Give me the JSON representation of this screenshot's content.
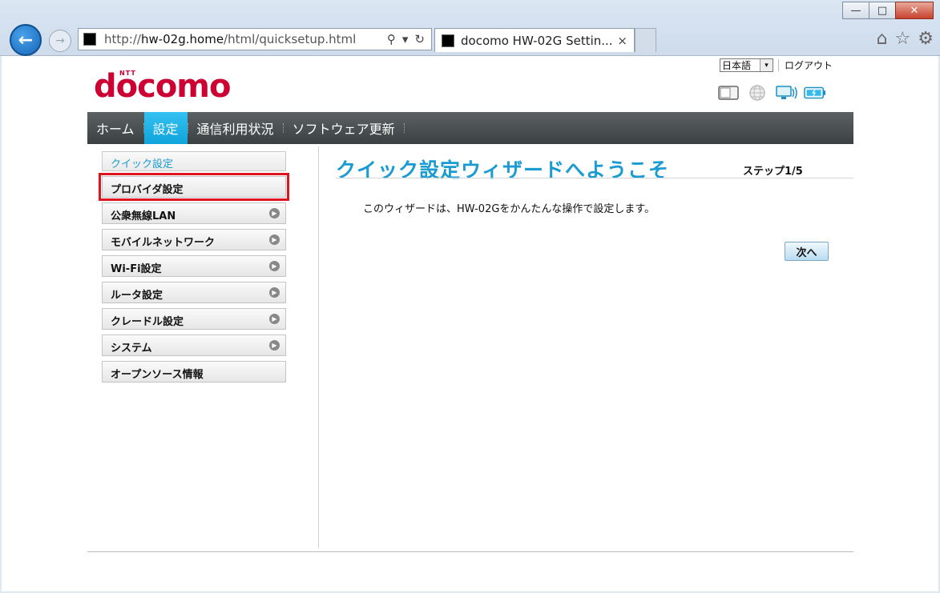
{
  "browser": {
    "url_prefix": "http://",
    "url_host": "hw-02g.home",
    "url_path": "/html/quicksetup.html",
    "tab_title": "docomo HW-02G Settin...",
    "tab_close": "×",
    "back_glyph": "←",
    "forward_glyph": "→",
    "window_buttons": {
      "minimize": "—",
      "maximize": "□",
      "close": "✕"
    },
    "address_icons": {
      "search": "⚲",
      "dropdown": "▾",
      "refresh": "↻"
    },
    "toolbar_icons": {
      "home": "⌂",
      "favorites": "☆",
      "settings": "⚙"
    }
  },
  "header": {
    "logo_text": "docomo",
    "logo_sub": "NTT",
    "language": "日本語",
    "language_arrow": "▾",
    "logout": "ログアウト",
    "status_icons": [
      "sim-icon",
      "globe-icon",
      "wifi-client-icon",
      "battery-icon"
    ]
  },
  "nav": {
    "items": [
      {
        "label": "ホーム"
      },
      {
        "label": "設定"
      },
      {
        "label": "通信利用状況"
      },
      {
        "label": "ソフトウェア更新"
      }
    ]
  },
  "sidebar": {
    "heading": "クイック設定",
    "items": [
      {
        "label": "プロバイダ設定"
      },
      {
        "label": "公衆無線LAN"
      },
      {
        "label": "モバイルネットワーク"
      },
      {
        "label": "Wi-Fi設定"
      },
      {
        "label": "ルータ設定"
      },
      {
        "label": "クレードル設定"
      },
      {
        "label": "システム"
      },
      {
        "label": "オープンソース情報"
      }
    ],
    "chevron_glyph": "▶"
  },
  "wizard": {
    "title": "クイック設定ウィザードへようこそ",
    "step": "ステップ1/5",
    "description": "このウィザードは、HW-02Gをかんたんな操作で設定します。",
    "next_button": "次へ"
  },
  "colors": {
    "brand_red": "#cc0033",
    "accent_blue": "#1a9bd1",
    "nav_active": "#10a4dc",
    "nav_bg": "#3b4142",
    "highlight_red": "#e0141e"
  }
}
